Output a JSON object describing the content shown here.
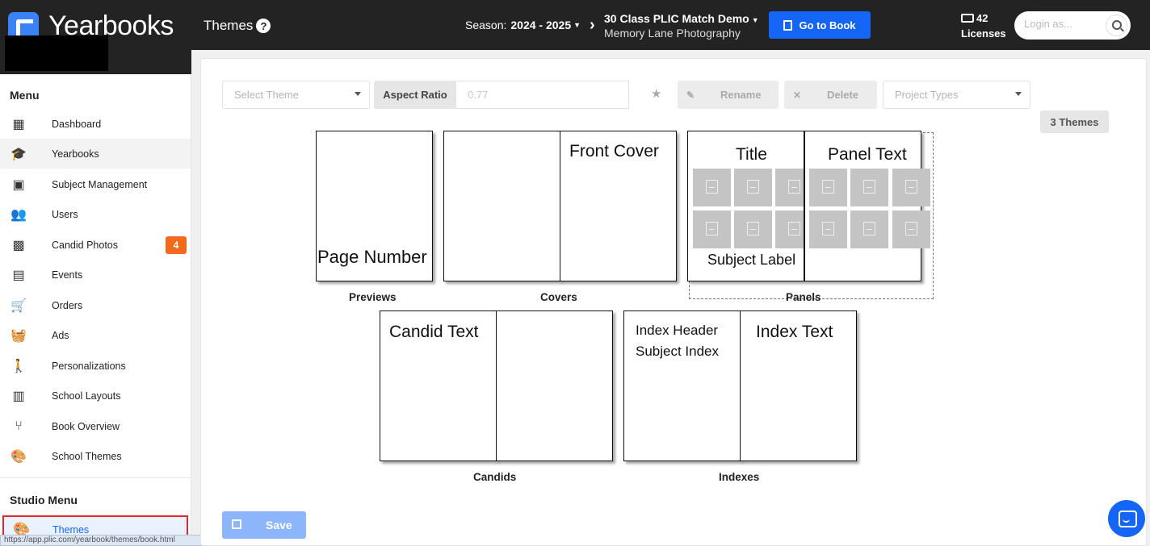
{
  "app": {
    "name": "Yearbooks"
  },
  "header": {
    "page_title": "Themes",
    "season_label": "Season:",
    "season_value": "2024 - 2025",
    "project_name": "30 Class PLIC Match Demo",
    "studio_name": "Memory Lane Photography",
    "go_to_book": "Go to Book",
    "licenses_count": "42",
    "licenses_label": "Licenses",
    "login_placeholder": "Login as..."
  },
  "sidebar": {
    "menu_title": "Menu",
    "items": [
      {
        "label": "Dashboard",
        "icon": "dashboard-icon"
      },
      {
        "label": "Yearbooks",
        "icon": "graduation-cap-icon"
      },
      {
        "label": "Subject Management",
        "icon": "id-card-icon"
      },
      {
        "label": "Users",
        "icon": "users-icon"
      },
      {
        "label": "Candid Photos",
        "icon": "photos-icon",
        "badge": "4"
      },
      {
        "label": "Events",
        "icon": "calendar-icon"
      },
      {
        "label": "Orders",
        "icon": "cart-icon"
      },
      {
        "label": "Ads",
        "icon": "basket-icon"
      },
      {
        "label": "Personalizations",
        "icon": "person-icon"
      },
      {
        "label": "School Layouts",
        "icon": "layout-icon"
      },
      {
        "label": "Book Overview",
        "icon": "merge-icon"
      },
      {
        "label": "School Themes",
        "icon": "palette-icon"
      }
    ],
    "studio_menu_title": "Studio Menu",
    "studio_items": [
      {
        "label": "Themes",
        "icon": "palette-icon"
      }
    ],
    "status_url": "https://app.plic.com/yearbook/themes/book.html"
  },
  "toolbar": {
    "select_theme_placeholder": "Select Theme",
    "aspect_ratio_label": "Aspect Ratio",
    "aspect_ratio_value": "0.77",
    "rename_label": "Rename",
    "delete_label": "Delete",
    "project_types_placeholder": "Project Types",
    "themes_count": "3 Themes"
  },
  "previews": {
    "previews": {
      "caption": "Previews",
      "text": "Page Number"
    },
    "covers": {
      "caption": "Covers",
      "text": "Front Cover"
    },
    "panels": {
      "caption": "Panels",
      "title": "Title",
      "panel_text": "Panel Text",
      "subject_label": "Subject Label"
    },
    "candids": {
      "caption": "Candids",
      "text": "Candid Text"
    },
    "indexes": {
      "caption": "Indexes",
      "header": "Index Header",
      "subject_index": "Subject Index",
      "text": "Index Text"
    }
  },
  "footer": {
    "save_label": "Save"
  },
  "colors": {
    "accent": "#1565f6",
    "topbar": "#232323",
    "badge": "#f26b1d",
    "highlight_border": "#e0282e"
  }
}
